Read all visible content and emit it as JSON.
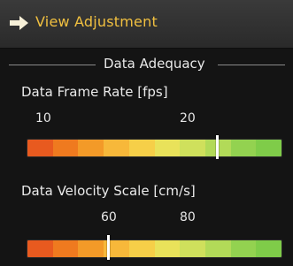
{
  "header": {
    "title": "View Adjustment",
    "icon": "arrow-right-icon"
  },
  "section": {
    "title": "Data Adequacy"
  },
  "frame_rate": {
    "label": "Data Frame Rate [fps]",
    "ticks": [
      "10",
      "20"
    ],
    "marker_fraction": 0.75
  },
  "velocity_scale": {
    "label": "Data Velocity Scale [cm/s]",
    "ticks": [
      "60",
      "80"
    ],
    "marker_fraction": 0.32
  },
  "gradient_colors": [
    "#e85a1f",
    "#ef7a1f",
    "#f39a28",
    "#f7b83a",
    "#f6cf48",
    "#e9e25a",
    "#cfe05c",
    "#b2da58",
    "#93d250",
    "#7fcc49"
  ]
}
